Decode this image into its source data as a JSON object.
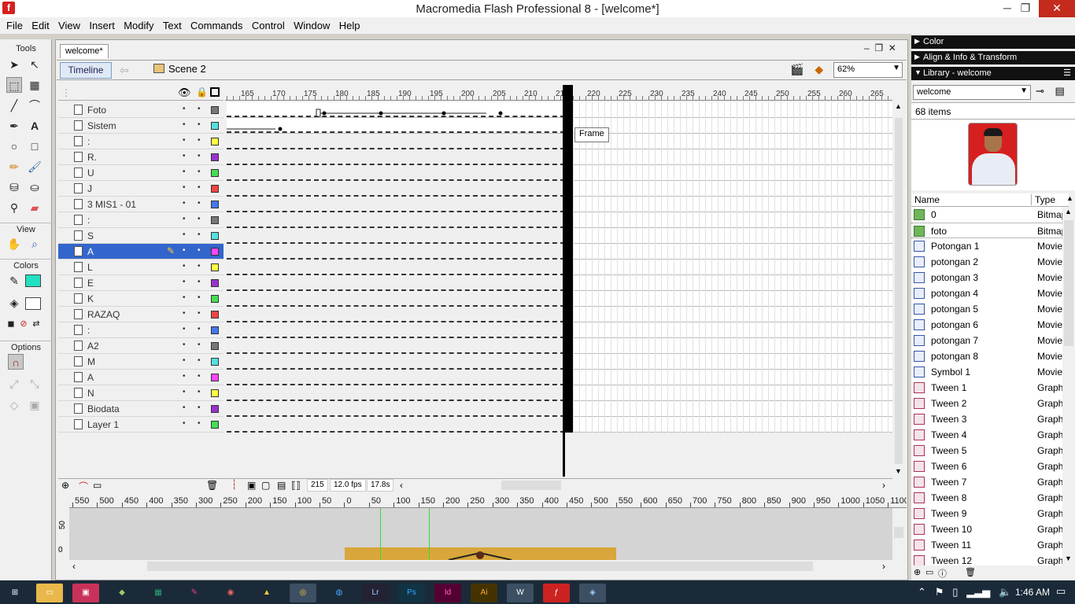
{
  "window": {
    "title": "Macromedia Flash Professional 8 - [welcome*]"
  },
  "menu": [
    "File",
    "Edit",
    "View",
    "Insert",
    "Modify",
    "Text",
    "Commands",
    "Control",
    "Window",
    "Help"
  ],
  "tools": {
    "title": "Tools",
    "view": "View",
    "colors": "Colors",
    "options": "Options"
  },
  "doc": {
    "tab": "welcome*",
    "timeline_btn": "Timeline",
    "scene": "Scene 2",
    "zoom": "62%"
  },
  "ruler_ticks": [
    "165",
    "170",
    "175",
    "180",
    "185",
    "190",
    "195",
    "200",
    "205",
    "210",
    "215",
    "220",
    "225",
    "230",
    "235",
    "240",
    "245",
    "250",
    "255",
    "260",
    "265"
  ],
  "layers": [
    {
      "name": "Foto",
      "color": "#777777"
    },
    {
      "name": "Sistem",
      "color": "#55e0e0"
    },
    {
      "name": ":",
      "color": "#ffff44"
    },
    {
      "name": "R.",
      "color": "#9933cc"
    },
    {
      "name": "U",
      "color": "#44dd55"
    },
    {
      "name": "J",
      "color": "#ee4444"
    },
    {
      "name": "3 MIS1 - 01",
      "color": "#4477ee"
    },
    {
      "name": ":",
      "color": "#777777"
    },
    {
      "name": "S",
      "color": "#55e0e0"
    },
    {
      "name": "A",
      "color": "#ff44ff"
    },
    {
      "name": "L",
      "color": "#ffff44"
    },
    {
      "name": "E",
      "color": "#9933cc"
    },
    {
      "name": "K",
      "color": "#44dd55"
    },
    {
      "name": "RAZAQ",
      "color": "#ee4444"
    },
    {
      "name": ":",
      "color": "#4477ee"
    },
    {
      "name": "A2",
      "color": "#777777"
    },
    {
      "name": "M",
      "color": "#55e0e0"
    },
    {
      "name": "A",
      "color": "#ff44ff"
    },
    {
      "name": "N",
      "color": "#ffff44"
    },
    {
      "name": "Biodata",
      "color": "#9933cc"
    },
    {
      "name": "Layer 1",
      "color": "#44dd55"
    }
  ],
  "timeline": {
    "frame": "215",
    "fps": "12.0 fps",
    "time": "17.8s",
    "tooltip": "Frame"
  },
  "stage_ruler": [
    "550",
    "500",
    "450",
    "400",
    "350",
    "300",
    "250",
    "200",
    "150",
    "100",
    "50",
    "0",
    "50",
    "100",
    "150",
    "200",
    "250",
    "300",
    "350",
    "400",
    "450",
    "500",
    "550",
    "600",
    "650",
    "700",
    "750",
    "800",
    "850",
    "900",
    "950",
    "1000",
    "1050",
    "1100"
  ],
  "stage_vruler": [
    "50",
    "0"
  ],
  "panels": {
    "color": "Color",
    "align": "Align & Info & Transform",
    "library": "Library - welcome"
  },
  "library": {
    "selector": "welcome",
    "count": "68 items",
    "col_name": "Name",
    "col_type": "Type",
    "items": [
      {
        "name": "0",
        "type": "Bitmap",
        "kind": "bmp"
      },
      {
        "name": "foto",
        "type": "Bitmap",
        "kind": "bmp"
      },
      {
        "name": "Potongan 1",
        "type": "Movie",
        "kind": "mv"
      },
      {
        "name": "potongan 2",
        "type": "Movie",
        "kind": "mv"
      },
      {
        "name": "potongan 3",
        "type": "Movie",
        "kind": "mv"
      },
      {
        "name": "potongan 4",
        "type": "Movie",
        "kind": "mv"
      },
      {
        "name": "potongan 5",
        "type": "Movie",
        "kind": "mv"
      },
      {
        "name": "potongan 6",
        "type": "Movie",
        "kind": "mv"
      },
      {
        "name": "potongan 7",
        "type": "Movie",
        "kind": "mv"
      },
      {
        "name": "potongan 8",
        "type": "Movie",
        "kind": "mv"
      },
      {
        "name": "Symbol 1",
        "type": "Movie",
        "kind": "mv"
      },
      {
        "name": "Tween 1",
        "type": "Graph",
        "kind": "gr"
      },
      {
        "name": "Tween 2",
        "type": "Graph",
        "kind": "gr"
      },
      {
        "name": "Tween 3",
        "type": "Graph",
        "kind": "gr"
      },
      {
        "name": "Tween 4",
        "type": "Graph",
        "kind": "gr"
      },
      {
        "name": "Tween 5",
        "type": "Graph",
        "kind": "gr"
      },
      {
        "name": "Tween 6",
        "type": "Graph",
        "kind": "gr"
      },
      {
        "name": "Tween 7",
        "type": "Graph",
        "kind": "gr"
      },
      {
        "name": "Tween 8",
        "type": "Graph",
        "kind": "gr"
      },
      {
        "name": "Tween 9",
        "type": "Graph",
        "kind": "gr"
      },
      {
        "name": "Tween 10",
        "type": "Graph",
        "kind": "gr"
      },
      {
        "name": "Tween 11",
        "type": "Graph",
        "kind": "gr"
      },
      {
        "name": "Tween 12",
        "type": "Graph",
        "kind": "gr"
      }
    ]
  },
  "taskbar": {
    "clock": "1:46 AM",
    "apps": [
      "start-icon",
      "file-explorer-icon",
      "app-icon-1",
      "app-icon-2",
      "excel-icon",
      "app-icon-3",
      "app-icon-4",
      "app-icon-5",
      "chrome-icon",
      "app-icon-6",
      "lightroom-icon",
      "photoshop-icon",
      "indesign-icon",
      "illustrator-icon",
      "word-icon",
      "flash-icon",
      "app-icon-7"
    ],
    "app_labels": {
      "lr": "Lr",
      "ps": "Ps",
      "id": "Id",
      "ai": "Ai",
      "w": "W"
    }
  }
}
